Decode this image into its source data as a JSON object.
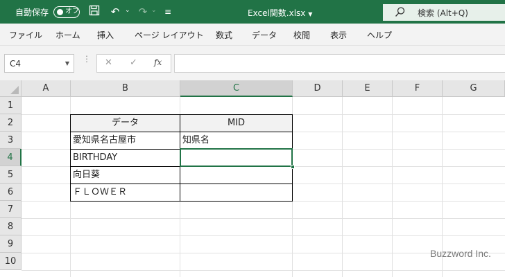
{
  "titlebar": {
    "autosave_label": "自動保存",
    "autosave_toggle": "オフ",
    "filename": "Excel関数.xlsx",
    "search_label": "検索 (Alt+Q)"
  },
  "menu": [
    "ファイル",
    "ホーム",
    "挿入",
    "ページ レイアウト",
    "数式",
    "データ",
    "校閲",
    "表示",
    "ヘルプ"
  ],
  "formula_bar": {
    "name_box": "C4",
    "formula": ""
  },
  "columns": [
    "A",
    "B",
    "C",
    "D",
    "E",
    "F",
    "G"
  ],
  "rows": [
    "1",
    "2",
    "3",
    "4",
    "5",
    "6",
    "7",
    "8",
    "9",
    "10"
  ],
  "active_cell": "C4",
  "table": {
    "header": [
      "データ",
      "MID"
    ],
    "rows": [
      [
        "愛知県名古屋市",
        "知県名"
      ],
      [
        "BIRTHDAY",
        ""
      ],
      [
        "向日葵",
        ""
      ],
      [
        "ＦＬＯＷＥＲ",
        ""
      ]
    ]
  },
  "watermark": "Buzzword Inc.",
  "colors": {
    "accent": "#217346"
  }
}
